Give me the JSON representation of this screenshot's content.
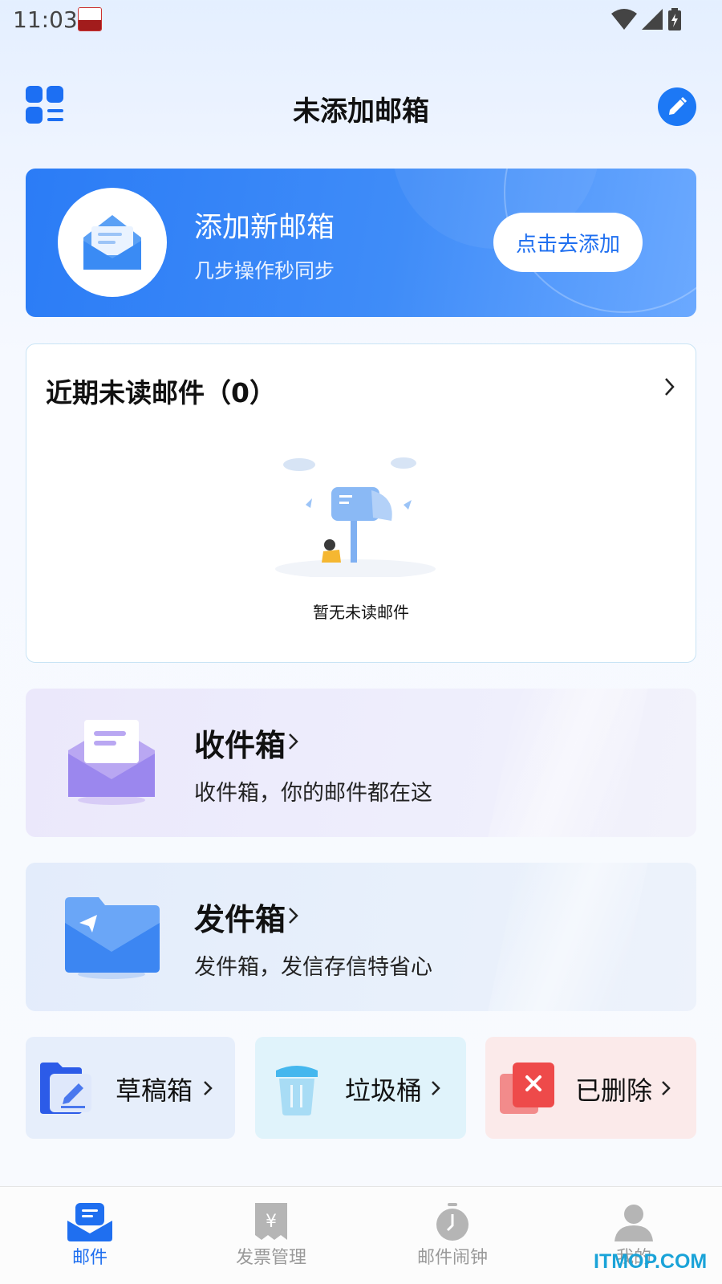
{
  "status_bar": {
    "time": "11:03"
  },
  "header": {
    "title": "未添加邮箱"
  },
  "banner": {
    "title": "添加新邮箱",
    "subtitle": "几步操作秒同步",
    "button_label": "点击去添加"
  },
  "unread": {
    "title": "近期未读邮件（0）",
    "empty_text": "暂无未读邮件"
  },
  "inbox": {
    "title": "收件箱",
    "subtitle": "收件箱，你的邮件都在这"
  },
  "outbox": {
    "title": "发件箱",
    "subtitle": "发件箱，发信存信特省心"
  },
  "shortcuts": [
    {
      "label": "草稿箱"
    },
    {
      "label": "垃圾桶"
    },
    {
      "label": "已删除"
    }
  ],
  "tabs": [
    {
      "label": "邮件",
      "icon": "mail-icon",
      "active": true
    },
    {
      "label": "发票管理",
      "icon": "invoice-icon",
      "active": false
    },
    {
      "label": "邮件闹钟",
      "icon": "clock-icon",
      "active": false
    },
    {
      "label": "我的",
      "icon": "user-icon",
      "active": false
    }
  ],
  "watermark": "ITMOP.COM",
  "colors": {
    "accent": "#1f6ff0",
    "banner": "#3f8cf8",
    "inactive_tab": "#9a9a9a"
  }
}
